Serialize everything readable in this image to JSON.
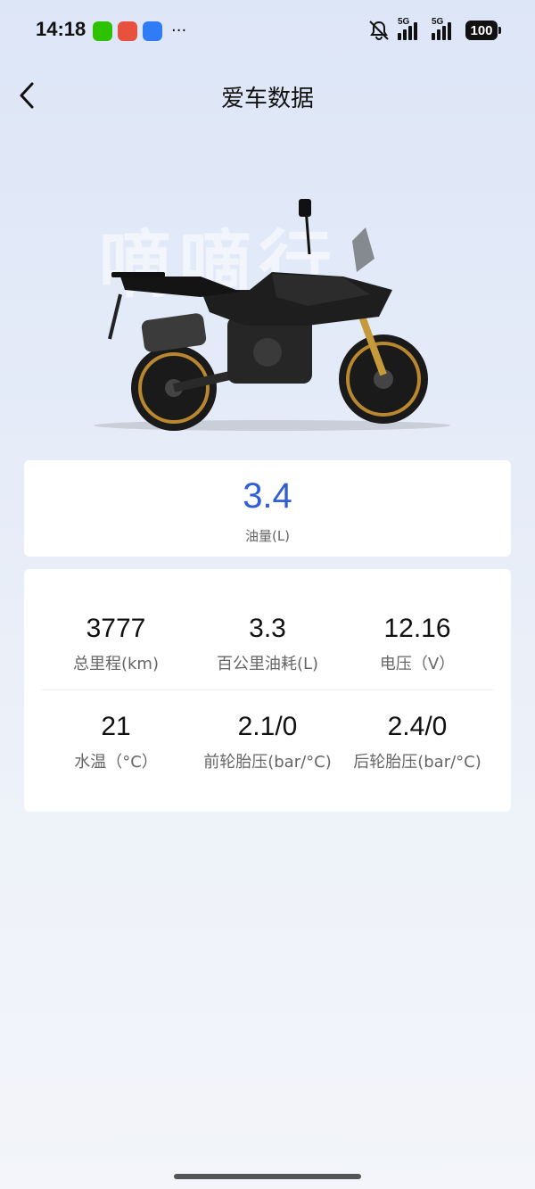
{
  "status_bar": {
    "time": "14:18",
    "more": "···",
    "signal1_tag": "5G",
    "signal2_tag": "5G",
    "battery": "100"
  },
  "header": {
    "title": "爱车数据",
    "back_icon": "chevron-left-icon"
  },
  "bike": {
    "watermark": "嘀嘀行"
  },
  "fuel": {
    "value": "3.4",
    "label": "油量(L)"
  },
  "stats": [
    {
      "value": "3777",
      "label": "总里程(km)"
    },
    {
      "value": "3.3",
      "label": "百公里油耗(L)"
    },
    {
      "value": "12.16",
      "label": "电压（V）"
    },
    {
      "value": "21",
      "label": "水温（°C）"
    },
    {
      "value": "2.1/0",
      "label": "前轮胎压(bar/°C)"
    },
    {
      "value": "2.4/0",
      "label": "后轮胎压(bar/°C)"
    }
  ],
  "colors": {
    "accent": "#2f5fd6",
    "background": "#e3eaf7"
  }
}
